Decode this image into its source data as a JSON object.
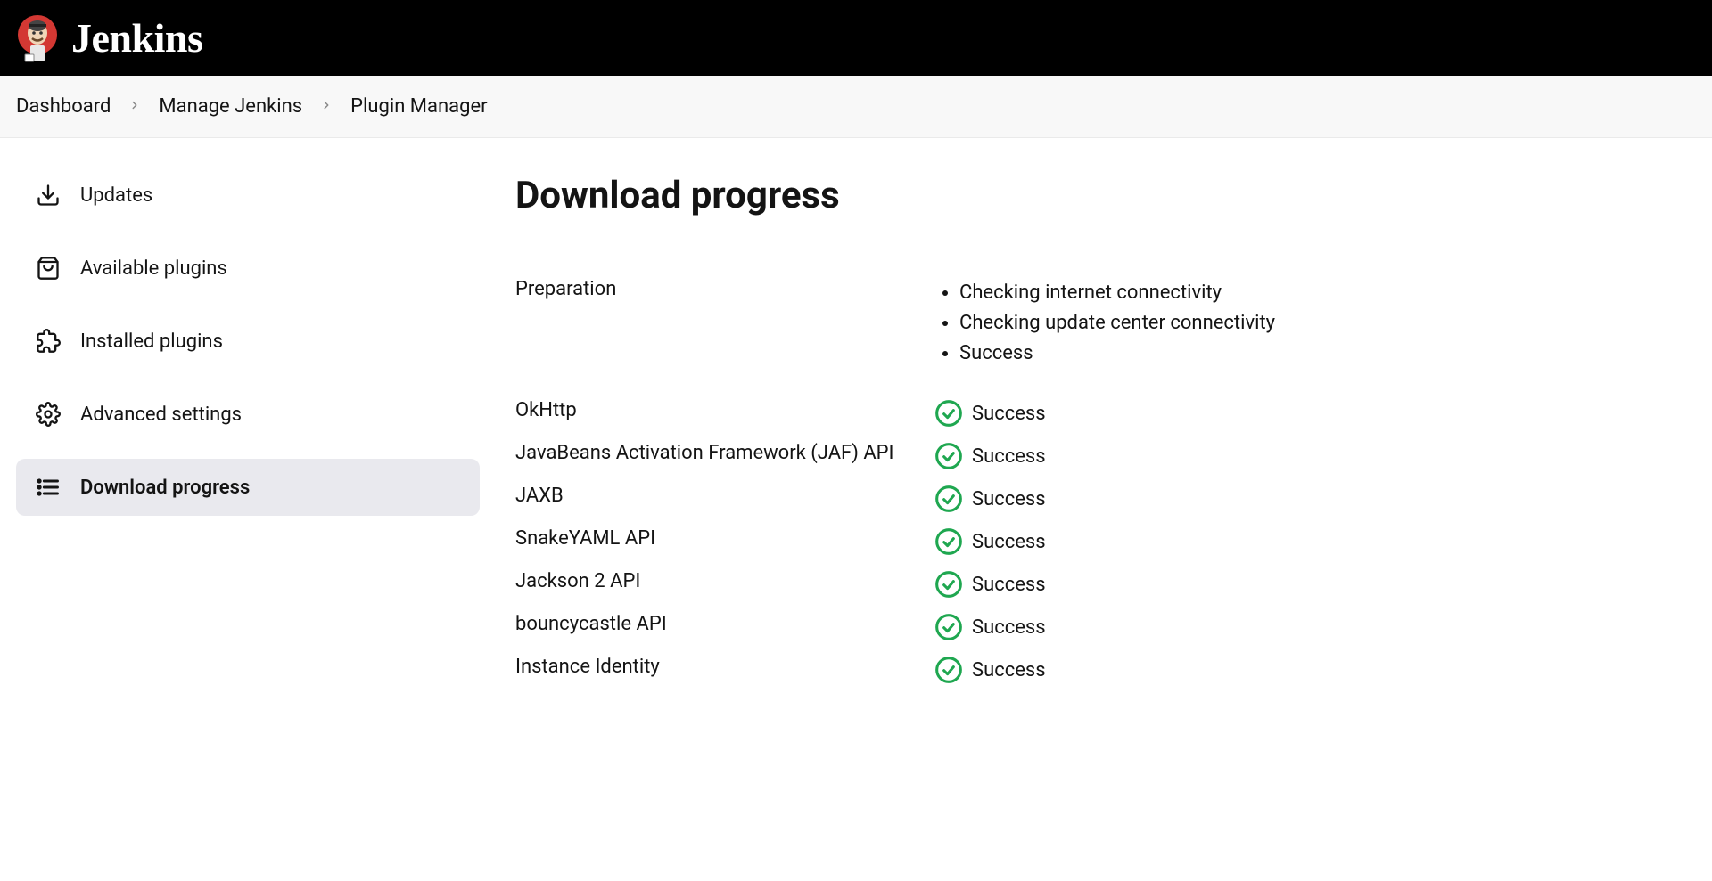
{
  "brand": "Jenkins",
  "breadcrumb": {
    "items": [
      "Dashboard",
      "Manage Jenkins",
      "Plugin Manager"
    ]
  },
  "sidebar": {
    "items": [
      {
        "label": "Updates",
        "icon": "download-icon",
        "active": false
      },
      {
        "label": "Available plugins",
        "icon": "bag-icon",
        "active": false
      },
      {
        "label": "Installed plugins",
        "icon": "puzzle-icon",
        "active": false
      },
      {
        "label": "Advanced settings",
        "icon": "gear-icon",
        "active": false
      },
      {
        "label": "Download progress",
        "icon": "list-icon",
        "active": true
      }
    ]
  },
  "main": {
    "title": "Download progress",
    "preparation": {
      "label": "Preparation",
      "steps": [
        "Checking internet connectivity",
        "Checking update center connectivity",
        "Success"
      ]
    },
    "items": [
      {
        "name": "OkHttp",
        "status": "Success"
      },
      {
        "name": "JavaBeans Activation Framework (JAF) API",
        "status": "Success"
      },
      {
        "name": "JAXB",
        "status": "Success"
      },
      {
        "name": "SnakeYAML API",
        "status": "Success"
      },
      {
        "name": "Jackson 2 API",
        "status": "Success"
      },
      {
        "name": "bouncycastle API",
        "status": "Success"
      },
      {
        "name": "Instance Identity",
        "status": "Success"
      }
    ]
  },
  "colors": {
    "success": "#1fa750"
  }
}
